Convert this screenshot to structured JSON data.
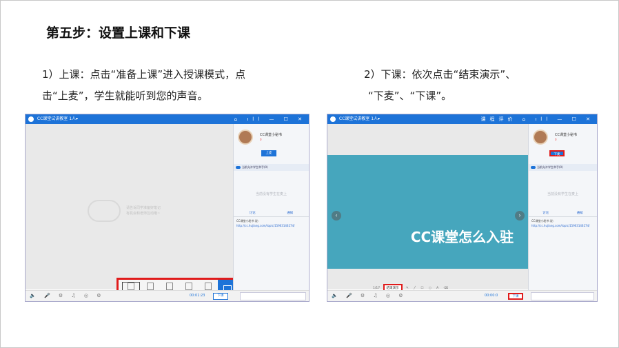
{
  "slide": {
    "title": "第五步：设置上课和下课",
    "left_text": [
      "1）上课：点击“准备上课”进入授课模式，点",
      "击“上麦”，学生就能听到您的声音。"
    ],
    "right_text": [
      "2）下课：依次点击“结束演示”、",
      "“下麦”、“下课”。"
    ]
  },
  "shot1": {
    "window_title": "CC课堂试讲教室  1人▾",
    "window_controls": "⌂ ıll — ☐ ✕",
    "user_name": "CC课堂小秘书",
    "user_count": "0",
    "mic_button": "上麦",
    "toggle_label": "当前允许学生举手(0)",
    "empty_message": "当前没有学生在麦上",
    "tab_discussion": "讨论",
    "tab_notice": "通知",
    "chat_sender": "CC课堂小秘书 说：",
    "chat_link": "http://cc.hujiang.com/topic/15903146274/",
    "placeholder_text": [
      "请告诉同学准备好笔记",
      "有机会和老师互动哦~"
    ],
    "tools": [
      "讲义",
      "画板",
      "摄像头",
      "分享文件",
      "大屏"
    ],
    "bottom_icons": "🔈 🎤 ⚙ ♫ ◎ ⚙",
    "timer": "00:01:23",
    "end_class": "下课"
  },
  "shot2": {
    "window_title": "CC课堂试讲教室  1人▾",
    "window_controls": "课程评价 ⌂ ıll — ☐ ✕",
    "user_name": "CC课堂小秘书",
    "user_count": "0",
    "mic_button": "下麦",
    "toggle_label": "当前允许学生举手(0)",
    "empty_message": "当前没有学生在麦上",
    "tab_discussion": "讨论",
    "tab_notice": "通知",
    "chat_sender": "CC课堂小秘书 说：",
    "chat_link": "http://cc.hujiang.com/topic/15903146274/",
    "banner_text": "CC课堂怎么入驻",
    "page_indicator": "1/17",
    "end_show": "结束演示",
    "draw_tools": "✎ ╱ ☐ ○ A ⌫",
    "bottom_icons": "🔈 🎤 ⚙ ♫ ◎ ⚙",
    "timer": "00:00:0",
    "end_class": "下课"
  }
}
